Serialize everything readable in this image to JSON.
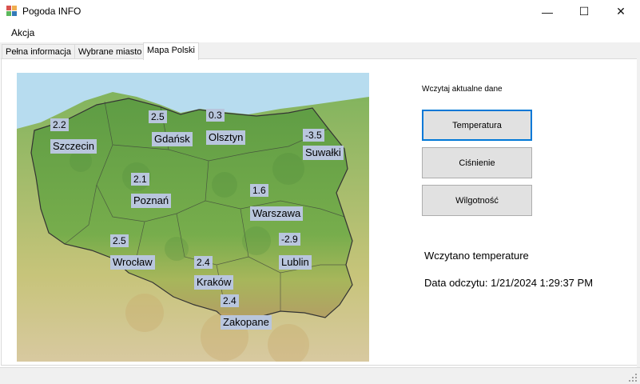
{
  "window": {
    "title": "Pogoda INFO",
    "minimize": "—",
    "maximize": "☐",
    "close": "✕"
  },
  "menu": {
    "items": [
      "Akcja"
    ]
  },
  "tabs": [
    "Pełna informacja",
    "Wybrane miasto",
    "Mapa Polski"
  ],
  "active_tab": "Mapa Polski",
  "map": {
    "cities": [
      {
        "name": "Szczecin",
        "value": "2.2"
      },
      {
        "name": "Gdańsk",
        "value": "2.5"
      },
      {
        "name": "Olsztyn",
        "value": "0.3"
      },
      {
        "name": "Suwałki",
        "value": "-3.5"
      },
      {
        "name": "Poznań",
        "value": "2.1"
      },
      {
        "name": "Warszawa",
        "value": "1.6"
      },
      {
        "name": "Wrocław",
        "value": "2.5"
      },
      {
        "name": "Lublin",
        "value": "-2.9"
      },
      {
        "name": "Kraków",
        "value": "2.4"
      },
      {
        "name": "Zakopane",
        "value": "2.4"
      }
    ]
  },
  "panel": {
    "load_label": "Wczytaj aktualne dane",
    "buttons": {
      "temperature": "Temperatura",
      "pressure": "Ciśnienie",
      "humidity": "Wilgotność"
    },
    "status": "Wczytano temperature",
    "timestamp": "Data odczytu: 1/21/2024 1:29:37 PM"
  },
  "colors": {
    "accent": "#0078d7",
    "label_bg": "#b9c6dd",
    "sea": "#b7dcef",
    "land": "#6aa64a"
  }
}
